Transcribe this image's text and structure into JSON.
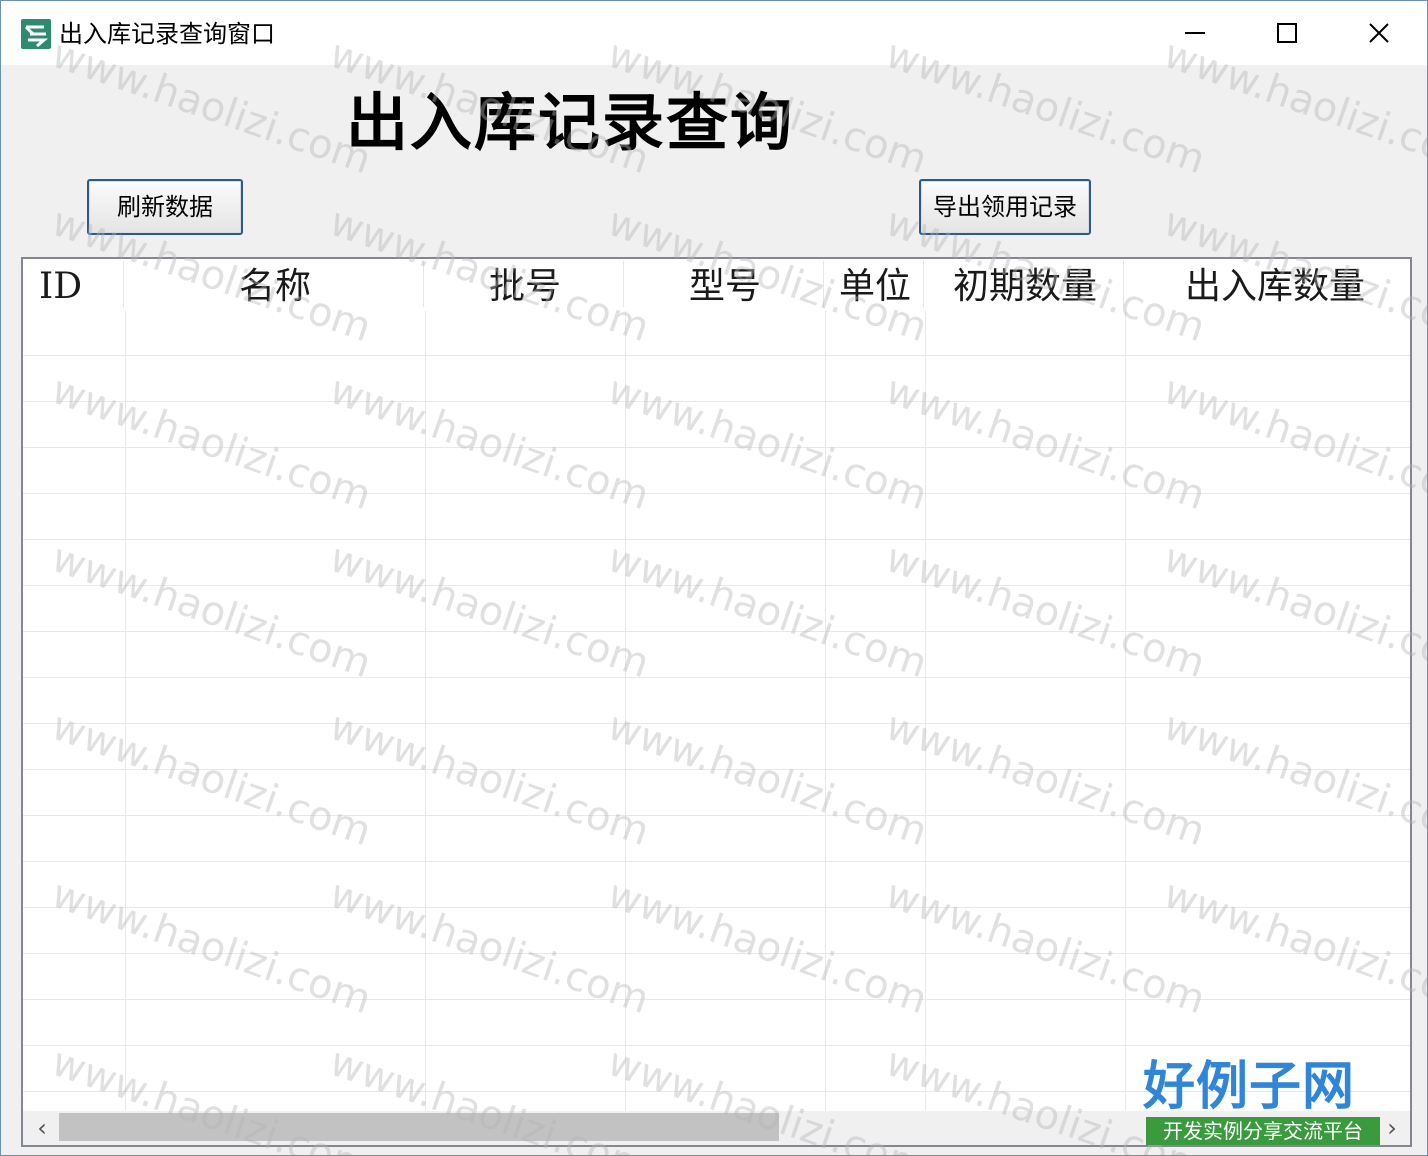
{
  "window": {
    "title": "出入库记录查询窗口",
    "controls": [
      "minimize-icon",
      "maximize-icon",
      "close-icon"
    ]
  },
  "heading": "出入库记录查询",
  "buttons": {
    "refresh": "刷新数据",
    "export": "导出领用记录"
  },
  "table": {
    "columns": [
      "ID",
      "名称",
      "批号",
      "型号",
      "单位",
      "初期数量",
      "出入库数量"
    ],
    "rows": []
  },
  "scrollbar": {
    "left_arrow": "‹",
    "right_arrow": "›"
  },
  "watermark": "www.haolizi.com",
  "logo": {
    "main": "好例子网",
    "sub": "开发实例分享交流平台"
  },
  "colors": {
    "title_bar": "#ffffff",
    "form_bg": "#f0f0f0",
    "logo_blue": "#2f86d6",
    "logo_green": "#3a9a3e"
  }
}
